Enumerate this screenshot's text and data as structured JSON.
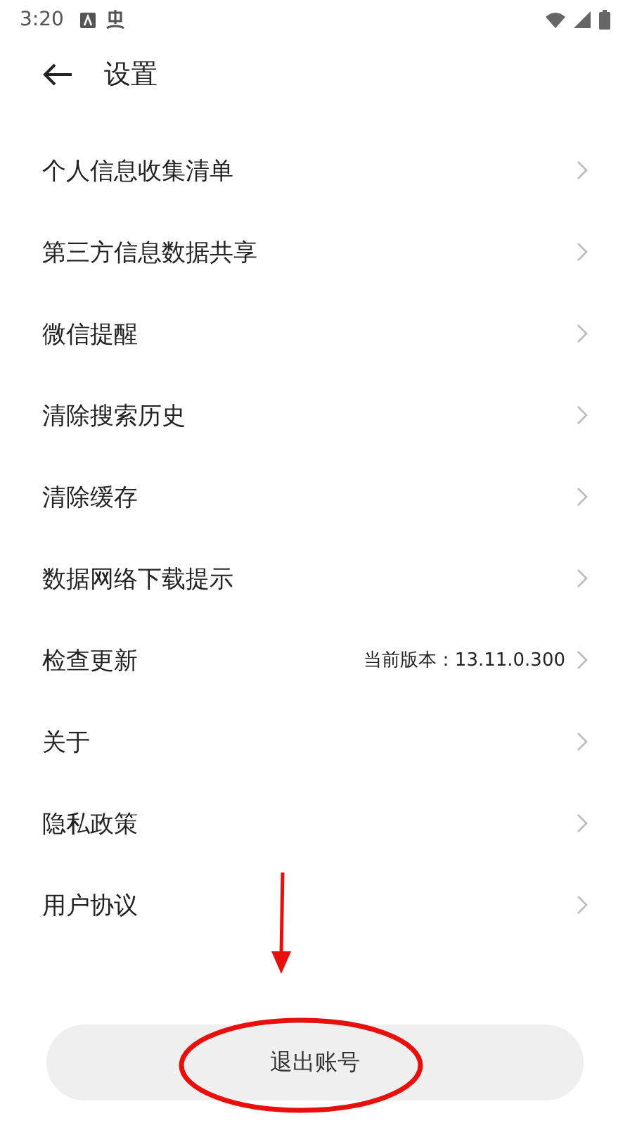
{
  "status_bar": {
    "time": "3:20"
  },
  "header": {
    "title": "设置"
  },
  "items": [
    {
      "label": "个人信息收集清单"
    },
    {
      "label": "第三方信息数据共享"
    },
    {
      "label": "微信提醒"
    },
    {
      "label": "清除搜索历史"
    },
    {
      "label": "清除缓存"
    },
    {
      "label": "数据网络下载提示"
    },
    {
      "label": "检查更新",
      "value": "当前版本：13.11.0.300"
    },
    {
      "label": "关于"
    },
    {
      "label": "隐私政策"
    },
    {
      "label": "用户协议"
    }
  ],
  "logout_button": {
    "label": "退出账号"
  }
}
